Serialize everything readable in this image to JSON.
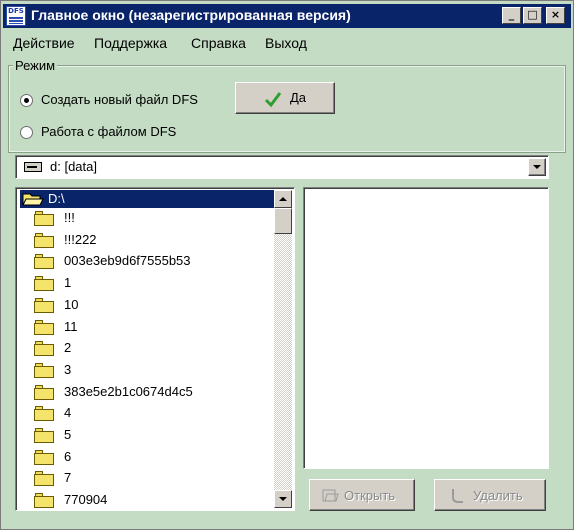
{
  "window": {
    "title": "Главное окно (незарегистрированная версия)",
    "icon_text": "DFS"
  },
  "title_buttons": [
    {
      "name": "minimize",
      "icon": "minimize-icon",
      "glyph": "_"
    },
    {
      "name": "maximize",
      "icon": "maximize-icon",
      "glyph": "□"
    },
    {
      "name": "close",
      "icon": "close-icon",
      "glyph": "×"
    }
  ],
  "menu": [
    "Действие",
    "Поддержка",
    "Справка",
    "Выход"
  ],
  "mode": {
    "label": "Режим",
    "options": [
      "Создать новый файл DFS",
      "Работа с файлом DFS"
    ],
    "selected_index": 0,
    "ok_label": "Да"
  },
  "drive": {
    "value": "d: [data]"
  },
  "tree": {
    "root": "D:\\",
    "folders": [
      "!!!",
      "!!!222",
      "003e3eb9d6f7555b53",
      "1",
      "10",
      "11",
      "2",
      "3",
      "383e5e2b1c0674d4c5",
      "4",
      "5",
      "6",
      "7",
      "770904"
    ]
  },
  "actions": {
    "open_label": "Открыть",
    "delete_label": "Удалить"
  },
  "colors": {
    "window_bg": "#c4dcc4",
    "title_bar": "#0a246a",
    "selection": "#0a246a",
    "check": "#2e9e2e"
  }
}
